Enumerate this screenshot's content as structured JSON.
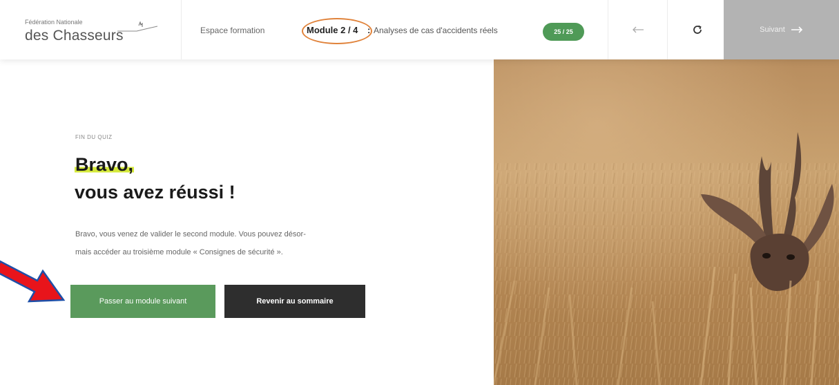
{
  "header": {
    "logo": {
      "small_text": "Fédération Nationale",
      "big_text": "des Chasseurs"
    },
    "section_label": "Espace formation",
    "module_label": "Module 2 / 4",
    "module_separator": ":",
    "module_title": "Analyses de cas d'accidents réels",
    "progress_badge": "25 / 25",
    "back_icon": "arrow-left-icon",
    "reload_icon": "reload-icon",
    "next_label": "Suivant",
    "next_icon": "arrow-right-icon"
  },
  "main": {
    "eyebrow": "FIN DU QUIZ",
    "heading_line1": "Bravo,",
    "heading_line2": "vous avez réussi !",
    "paragraph_line1": "Bravo, vous venez de valider le second module. Vous pouvez désor-",
    "paragraph_line2": "mais accéder au troisième module « Consignes de sécurité ».",
    "primary_button": "Passer au module suivant",
    "secondary_button": "Revenir au sommaire"
  },
  "colors": {
    "accent_green": "#5a9a5c",
    "badge_green": "#4f9a57",
    "highlight_yellow": "#d4e83b",
    "annotation_orange": "#e0823a",
    "annotation_red": "#e8141b",
    "next_button_gray": "#b3b3b3",
    "dark_button": "#2e2e2e"
  },
  "photo": {
    "subject": "roe deer in wheat field"
  }
}
